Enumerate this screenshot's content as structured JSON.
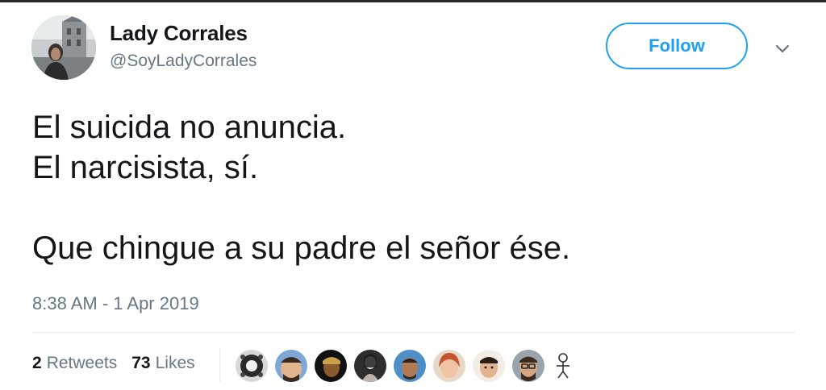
{
  "user": {
    "name": "Lady Corrales",
    "handle": "@SoyLadyCorrales"
  },
  "follow_label": "Follow",
  "tweet": {
    "lines": [
      "El suicida no anuncia.",
      "El narcisista, sí.",
      "Que chingue a su padre el señor ése."
    ],
    "timestamp": "8:38 AM - 1 Apr 2019"
  },
  "stats": {
    "retweets_count": "2",
    "retweets_label": "Retweets",
    "likes_count": "73",
    "likes_label": "Likes"
  },
  "colors": {
    "accent": "#1da1f2",
    "secondary_text": "#657786",
    "primary_text": "#14171a",
    "divider": "#e6ecf0"
  },
  "icons": {
    "menu": "chevron-down-icon"
  }
}
